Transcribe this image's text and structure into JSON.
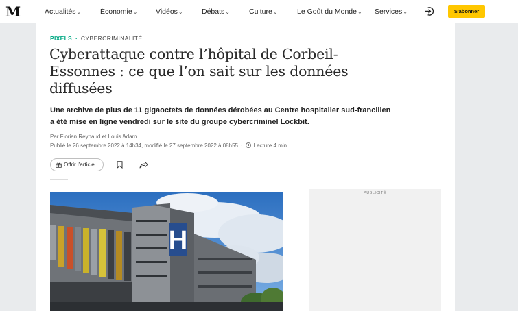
{
  "nav": {
    "logo": "M",
    "items": [
      {
        "label": "Actualités",
        "has_menu": true
      },
      {
        "label": "Économie",
        "has_menu": true
      },
      {
        "label": "Vidéos",
        "has_menu": true
      },
      {
        "label": "Débats",
        "has_menu": true
      },
      {
        "label": "Culture",
        "has_menu": true
      },
      {
        "label": "Le Goût du Monde",
        "has_menu": true
      },
      {
        "label": "Services",
        "has_menu": true
      }
    ],
    "chevron": "⌄",
    "login_icon": "login-icon",
    "subscribe_label": "S'abonner",
    "subscribe_color": "#ffc700"
  },
  "article": {
    "rubric": "PIXELS",
    "rubric_color": "#00a883",
    "separator": "·",
    "tag": "CYBERCRIMINALITÉ",
    "title": "Cyberattaque contre l’hôpital de Corbeil-Essonnes : ce que l’on sait sur les données diffusées",
    "chapo": "Une archive de plus de 11 gigaoctets de données dérobées au Centre hospitalier sud-francilien a été mise en ligne vendredi sur le site du groupe cybercriminel Lockbit.",
    "byline": "Par Florian Reynaud et Louis Adam",
    "published": "Publié le 26 septembre 2022 à 14h34, modifié le 27 septembre 2022 à 08h55",
    "meta_separator": "·",
    "reading_time": "Lecture 4 min.",
    "gift_label": "Offrir l’article",
    "icons": [
      "gift-icon",
      "bookmark-icon",
      "share-icon",
      "clock-icon"
    ]
  },
  "ad": {
    "label": "PUBLICITÉ"
  }
}
